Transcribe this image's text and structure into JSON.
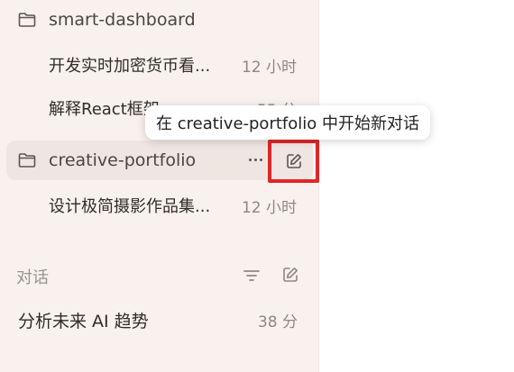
{
  "sidebar": {
    "projects": [
      {
        "name": "smart-dashboard",
        "chats": [
          {
            "title": "开发实时加密货币看...",
            "time": "12 小时"
          },
          {
            "title": "解释React框架",
            "time": "55 分"
          }
        ]
      },
      {
        "name": "creative-portfolio",
        "chats": [
          {
            "title": "设计极简摄影作品集...",
            "time": "12 小时"
          }
        ]
      }
    ],
    "tooltip": "在 creative-portfolio 中开始新对话",
    "conversations_section": {
      "label": "对话",
      "items": [
        {
          "title": "分析未来 AI 趋势",
          "time": "38 分"
        }
      ]
    }
  },
  "icons": {
    "folder": "folder-icon",
    "more": "more-icon",
    "new_chat": "new-chat-icon",
    "sort": "sort-icon",
    "compose": "compose-icon"
  },
  "colors": {
    "sidebar_bg": "#f8f1ee",
    "active_row_bg": "#efe6e2",
    "highlight": "#e12626"
  }
}
